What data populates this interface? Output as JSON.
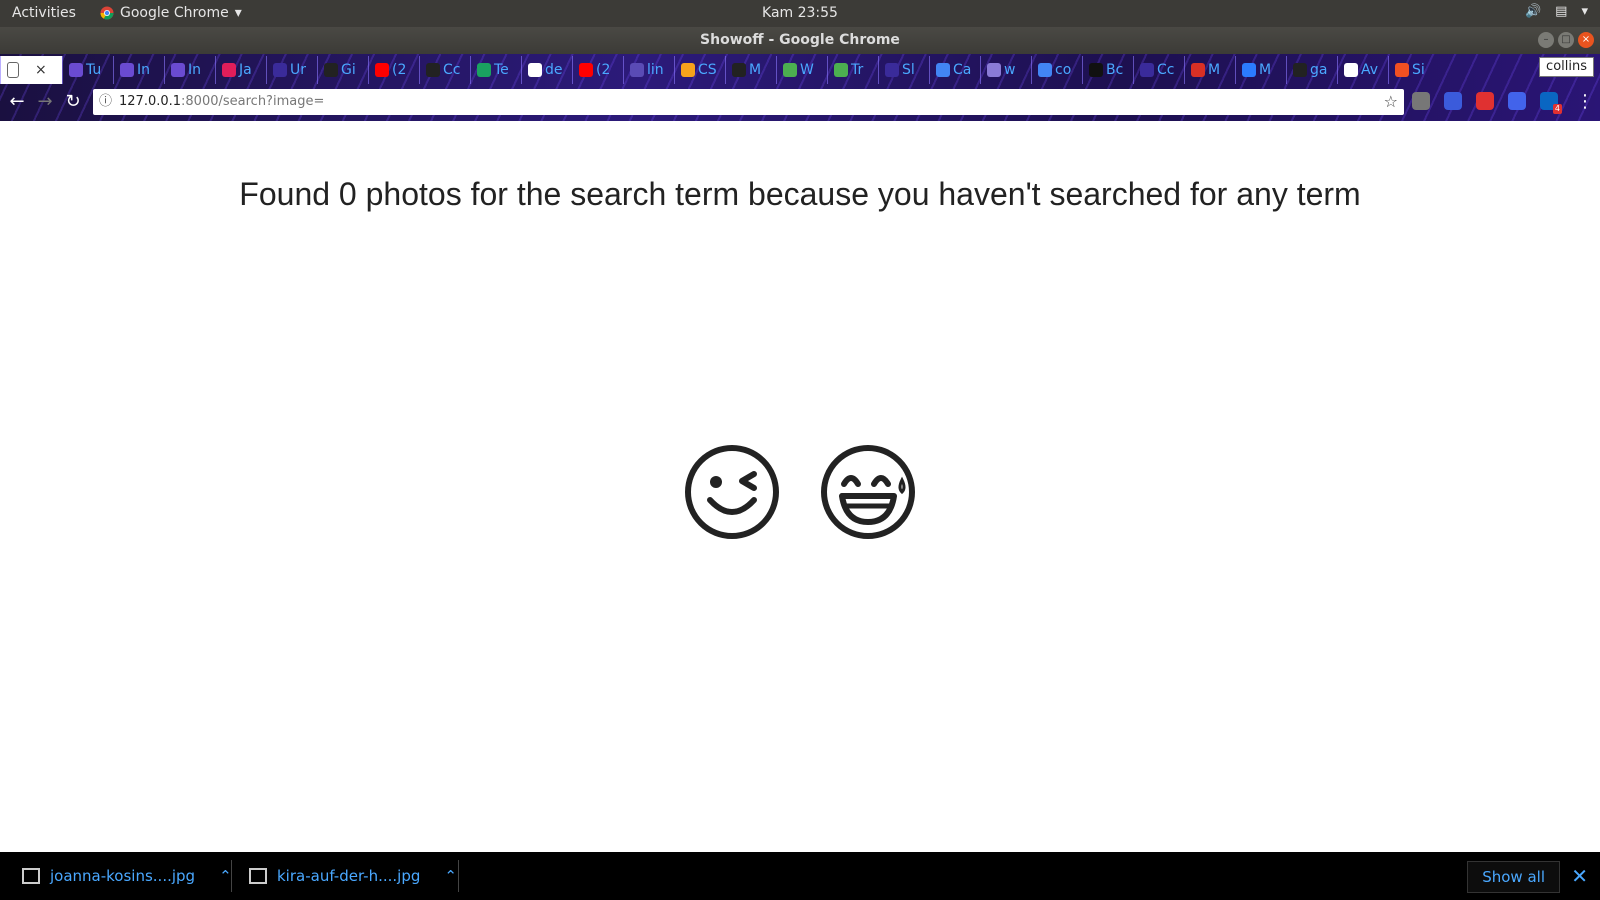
{
  "os_bar": {
    "activities": "Activities",
    "app_name": "Google Chrome",
    "clock": "Kam 23:55"
  },
  "window": {
    "title": "Showoff - Google Chrome"
  },
  "tabs": [
    {
      "label": "",
      "color": "#ffffff",
      "active": true
    },
    {
      "label": "Tu",
      "color": "#6a4bd1"
    },
    {
      "label": "In",
      "color": "#6a4bd1"
    },
    {
      "label": "In",
      "color": "#6a4bd1"
    },
    {
      "label": "Ja",
      "color": "#e01e5a"
    },
    {
      "label": "Ur",
      "color": "#3a2b9a"
    },
    {
      "label": "Gi",
      "color": "#222222"
    },
    {
      "label": "(2",
      "color": "#ff0000"
    },
    {
      "label": "Cc",
      "color": "#222222"
    },
    {
      "label": "Te",
      "color": "#1aa260"
    },
    {
      "label": "de",
      "color": "#ffffff"
    },
    {
      "label": "(2",
      "color": "#ff0000"
    },
    {
      "label": "lin",
      "color": "#5a4bb5"
    },
    {
      "label": "CS",
      "color": "#f7a21b"
    },
    {
      "label": "M",
      "color": "#222222"
    },
    {
      "label": "W",
      "color": "#4caf50"
    },
    {
      "label": "Tr",
      "color": "#4caf50"
    },
    {
      "label": "Sl",
      "color": "#3a2b9a"
    },
    {
      "label": "Ca",
      "color": "#4285f4"
    },
    {
      "label": "w",
      "color": "#8a7bd6"
    },
    {
      "label": "co",
      "color": "#4285f4"
    },
    {
      "label": "Bc",
      "color": "#111111"
    },
    {
      "label": "Cc",
      "color": "#3a2b9a"
    },
    {
      "label": "M",
      "color": "#d93025"
    },
    {
      "label": "M",
      "color": "#2b7bff"
    },
    {
      "label": "ga",
      "color": "#222222"
    },
    {
      "label": "Av",
      "color": "#ffffff"
    },
    {
      "label": "Si",
      "color": "#f25022"
    }
  ],
  "profile": "collins",
  "omnibox": {
    "host": "127.0.0.1",
    "path": ":8000/search?image="
  },
  "extensions": [
    {
      "name": "globe-extension-icon",
      "color": "#777777"
    },
    {
      "name": "search-extension-icon",
      "color": "#3b5bdb"
    },
    {
      "name": "stop-extension-icon",
      "color": "#e03131"
    },
    {
      "name": "shield-extension-icon",
      "color": "#4263eb"
    },
    {
      "name": "linkedin-extension-icon",
      "color": "#0a66c2",
      "badge": "4"
    }
  ],
  "main": {
    "heading": "Found 0 photos for the search term because you haven't searched for any term"
  },
  "downloads": {
    "items": [
      {
        "name": "joanna-kosins....jpg"
      },
      {
        "name": "kira-auf-der-h....jpg"
      }
    ],
    "show_all": "Show all"
  }
}
